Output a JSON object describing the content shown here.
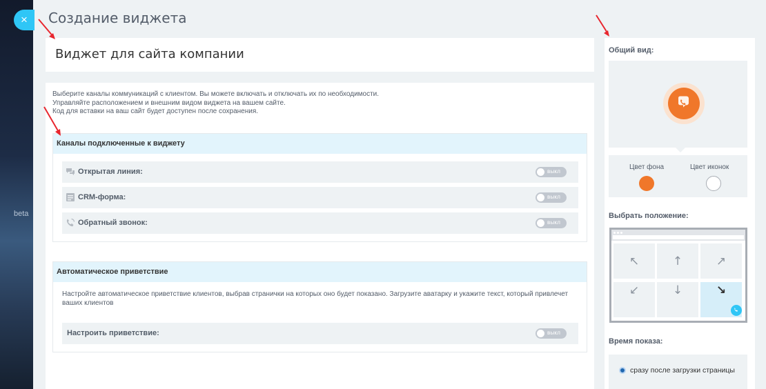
{
  "window": {
    "close_label": "×",
    "side_text": "beta"
  },
  "page_title": "Создание виджета",
  "widget_name": "Виджет для сайта компании",
  "intro_lines": [
    "Выберите каналы коммуникаций с клиентом. Вы можете включать и отключать их по необходимости.",
    "Управляйте расположением и внешним видом виджета на вашем сайте.",
    "Код для вставки на ваш сайт будет доступен после сохранения."
  ],
  "channels": {
    "header": "Каналы подключенные к виджету",
    "items": [
      {
        "label": "Открытая линия:",
        "icon": "chat-bubbles-icon",
        "toggle": "выкл"
      },
      {
        "label": "CRM-форма:",
        "icon": "form-icon",
        "toggle": "выкл"
      },
      {
        "label": "Обратный звонок:",
        "icon": "phone-callback-icon",
        "toggle": "выкл"
      }
    ]
  },
  "greeting": {
    "header": "Автоматическое приветствие",
    "description": "Настройте автоматическое приветствие клиентов, выбрав странички на которых оно будет показано. Загрузите аватарку и укажите текст, который привлечет ваших клиентов",
    "setting_label": "Настроить приветствие:",
    "toggle": "выкл"
  },
  "sidebar": {
    "overview_title": "Общий вид:",
    "bg_color_label": "Цвет фона",
    "icon_color_label": "Цвет иконок",
    "bg_color": "#f0772a",
    "icon_color": "#ffffff",
    "position_title": "Выбрать положение:",
    "position_arrows": [
      "↖",
      "↑",
      "↗",
      "↙",
      "↓",
      "↘"
    ],
    "selected_position": "↘",
    "show_time_title": "Время показа:",
    "show_time_option": "сразу после загрузки страницы"
  },
  "colors": {
    "accent_blue": "#2fc6f6",
    "widget_orange": "#f0772a",
    "header_blue": "#e2f4fc",
    "annotation_red": "#e8262e"
  }
}
